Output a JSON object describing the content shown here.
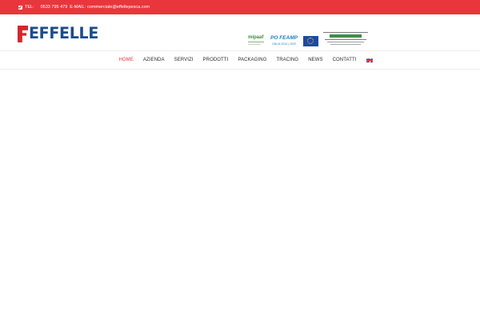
{
  "topbar": {
    "tel_label": "TEL:",
    "tel_number": "0533 795 479",
    "email_label": "E-MAIL:",
    "email_value": "commerciale@effellepesca.com"
  },
  "header": {
    "logo_text": "EFFELLE",
    "sponsors": {
      "mipaaf": "mipaaf",
      "pofeamp_title": "PO FEAMP",
      "pofeamp_sub": "ITALIA 2014 | 2020"
    }
  },
  "nav": {
    "items": [
      {
        "label": "HOME"
      },
      {
        "label": "AZIENDA"
      },
      {
        "label": "SERVIZI"
      },
      {
        "label": "PRODOTTI"
      },
      {
        "label": "PACKAGING"
      },
      {
        "label": "TRACING"
      },
      {
        "label": "NEWS"
      },
      {
        "label": "CONTATTI"
      }
    ],
    "active_index": 0,
    "language_icon": "uk-flag-icon"
  },
  "colors": {
    "topbar_bg": "#e8363c",
    "nav_active": "#e8363c",
    "logo_blue": "#1c4c8c",
    "logo_red": "#d8252b"
  }
}
